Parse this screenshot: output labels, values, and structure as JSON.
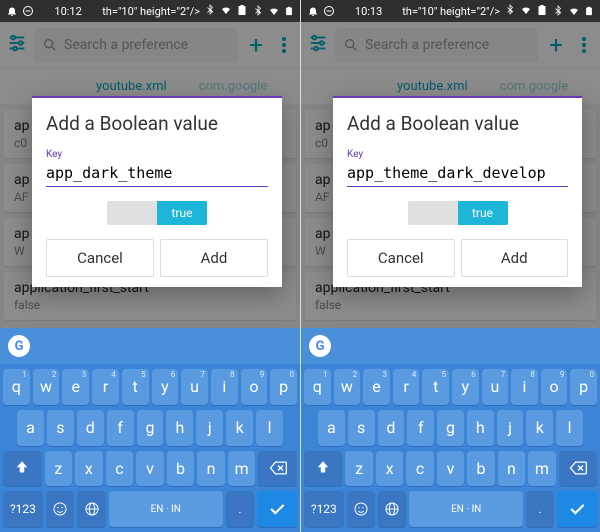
{
  "screens": [
    {
      "status": {
        "time": "10:12",
        "icons": [
          "bell",
          "dnd",
          "bluetooth",
          "wifi",
          "battery"
        ]
      },
      "search_placeholder": "Search a preference",
      "tabs": {
        "active": "youtube.xml",
        "inactive": "com.google"
      },
      "bg_items": [
        {
          "k": "ap",
          "v": "c0"
        },
        {
          "k": "ap",
          "v": "AF"
        },
        {
          "k": "ap",
          "v": "W"
        },
        {
          "k": "application_first_start",
          "v": "false"
        }
      ],
      "dialog": {
        "title": "Add a Boolean value",
        "key_label": "Key",
        "key_value": "app_dark_theme",
        "toggle_value": "true",
        "cancel": "Cancel",
        "add": "Add"
      }
    },
    {
      "status": {
        "time": "10:13",
        "icons": [
          "bell",
          "dnd",
          "bluetooth",
          "wifi",
          "battery"
        ]
      },
      "search_placeholder": "Search a preference",
      "tabs": {
        "active": "youtube.xml",
        "inactive": "com.google"
      },
      "bg_items": [
        {
          "k": "ap",
          "v": "c0"
        },
        {
          "k": "ap",
          "v": "AF"
        },
        {
          "k": "ap",
          "v": "W"
        },
        {
          "k": "application_first_start",
          "v": "false"
        }
      ],
      "dialog": {
        "title": "Add a Boolean value",
        "key_label": "Key",
        "key_value": "app_theme_dark_develop",
        "toggle_value": "true",
        "cancel": "Cancel",
        "add": "Add"
      }
    }
  ],
  "keyboard": {
    "row1": [
      [
        "q",
        "1"
      ],
      [
        "w",
        "2"
      ],
      [
        "e",
        "3"
      ],
      [
        "r",
        "4"
      ],
      [
        "t",
        "5"
      ],
      [
        "y",
        "6"
      ],
      [
        "u",
        "7"
      ],
      [
        "i",
        "8"
      ],
      [
        "o",
        "9"
      ],
      [
        "p",
        "0"
      ]
    ],
    "row2": [
      "a",
      "s",
      "d",
      "f",
      "g",
      "h",
      "j",
      "k",
      "l"
    ],
    "row3": [
      "z",
      "x",
      "c",
      "v",
      "b",
      "n",
      "m"
    ],
    "sym": "?123",
    "space": "EN · IN"
  }
}
